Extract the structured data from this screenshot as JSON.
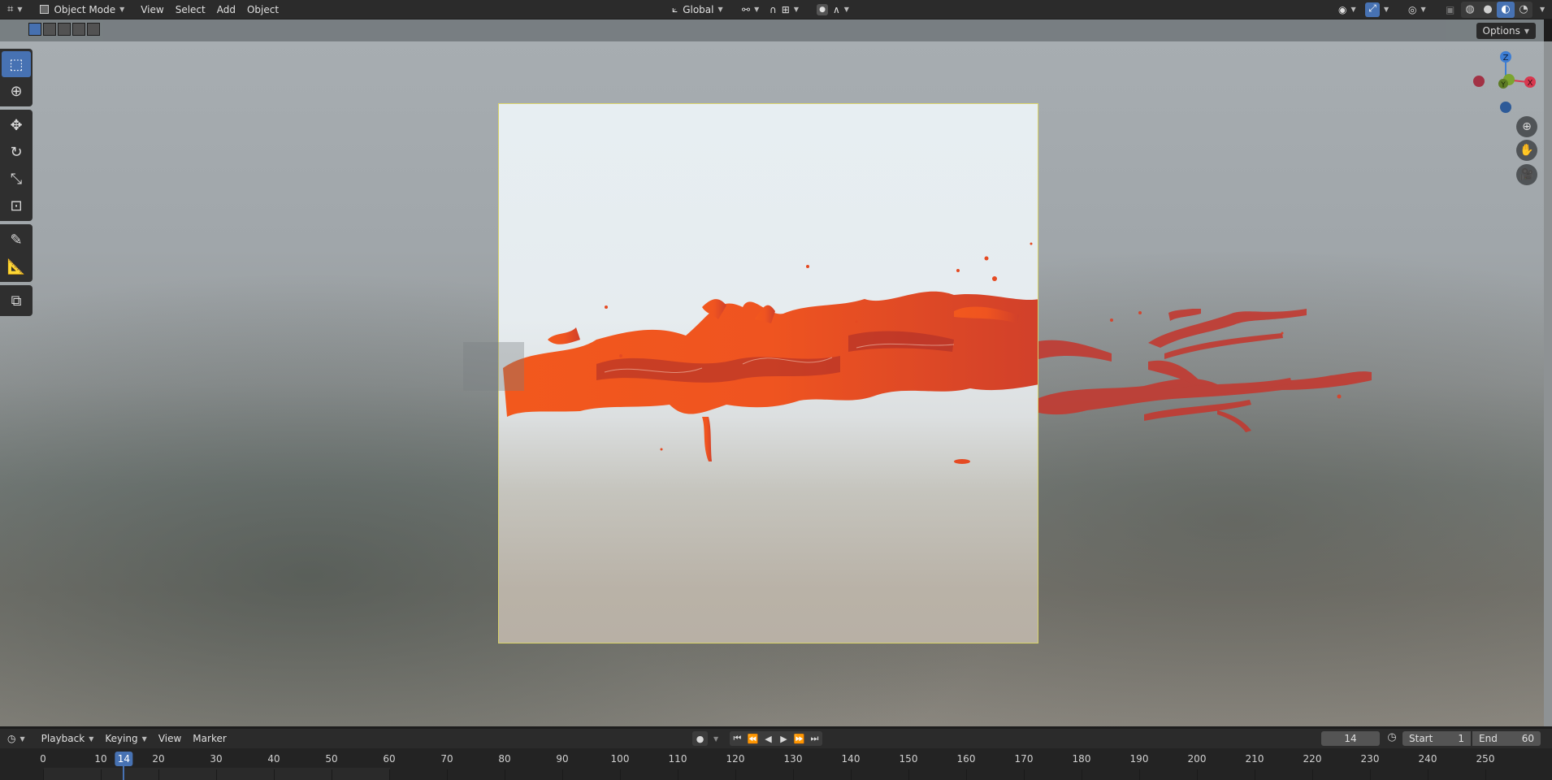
{
  "header": {
    "mode_label": "Object Mode",
    "menus": [
      "View",
      "Select",
      "Add",
      "Object"
    ],
    "orientation_label": "Global"
  },
  "subheader": {
    "options_label": "Options"
  },
  "gizmo": {
    "axis_z": "Z",
    "axis_x": "X",
    "axis_y": "Y"
  },
  "timeline": {
    "menus": {
      "playback": "Playback",
      "keying": "Keying",
      "view": "View",
      "marker": "Marker"
    },
    "current_frame": "14",
    "start_label": "Start",
    "start_value": "1",
    "end_label": "End",
    "end_value": "60",
    "ruler_labels": [
      "0",
      "10",
      "20",
      "30",
      "40",
      "50",
      "60",
      "70",
      "80",
      "90",
      "100",
      "110",
      "120",
      "130",
      "140",
      "150",
      "160",
      "170",
      "180",
      "190",
      "200",
      "210",
      "220",
      "230",
      "240",
      "250"
    ],
    "ruler_values": [
      0,
      10,
      20,
      30,
      40,
      50,
      60,
      70,
      80,
      90,
      100,
      110,
      120,
      130,
      140,
      150,
      160,
      170,
      180,
      190,
      200,
      210,
      220,
      230,
      240,
      250
    ],
    "frame_indicator": "14",
    "frame_value": 14
  },
  "colors": {
    "accent": "#4772b3",
    "splash": "#f0561e",
    "splash_dark": "#a82b2a",
    "camera_border": "#d9d36a",
    "axis_x": "#d8384f",
    "axis_y": "#7ba42f",
    "axis_z": "#3d7dd3"
  }
}
